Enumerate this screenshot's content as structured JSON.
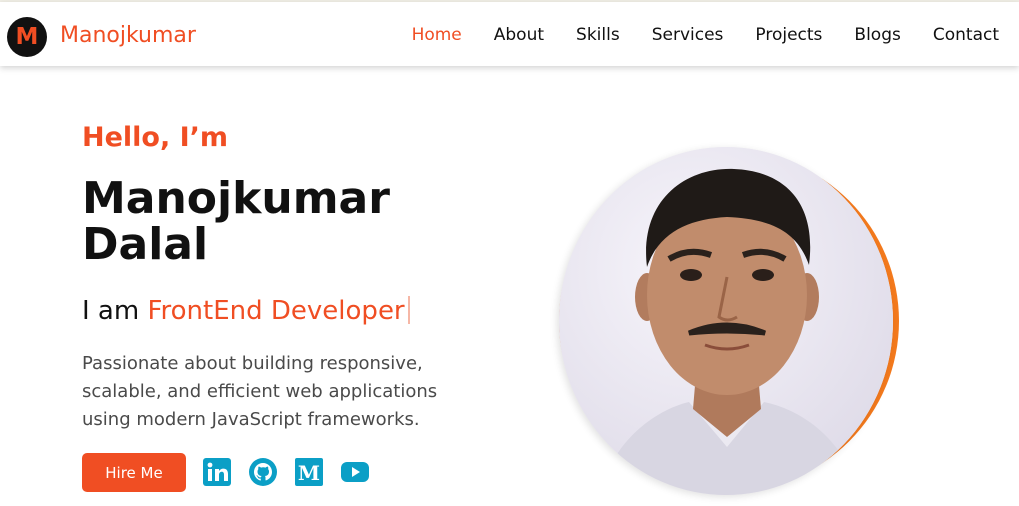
{
  "brand": {
    "logo_letter": "M",
    "name": "Manojkumar"
  },
  "nav": {
    "items": [
      {
        "label": "Home",
        "active": true
      },
      {
        "label": "About"
      },
      {
        "label": "Skills"
      },
      {
        "label": "Services"
      },
      {
        "label": "Projects"
      },
      {
        "label": "Blogs"
      },
      {
        "label": "Contact"
      }
    ]
  },
  "hero": {
    "greeting": "Hello, I’m",
    "name": "Manojkumar Dalal",
    "role_prefix": "I am",
    "role_highlight": "FrontEnd Developer",
    "description": "Passionate about building responsive, scalable, and efficient web applications using modern JavaScript frameworks.",
    "cta_label": "Hire Me"
  },
  "social_icons": [
    "linkedin-icon",
    "github-icon",
    "medium-icon",
    "youtube-icon"
  ],
  "colors": {
    "accent": "#f04e23",
    "ring": "#f47a1d",
    "social": "#0b9fc6",
    "text": "#111111"
  }
}
